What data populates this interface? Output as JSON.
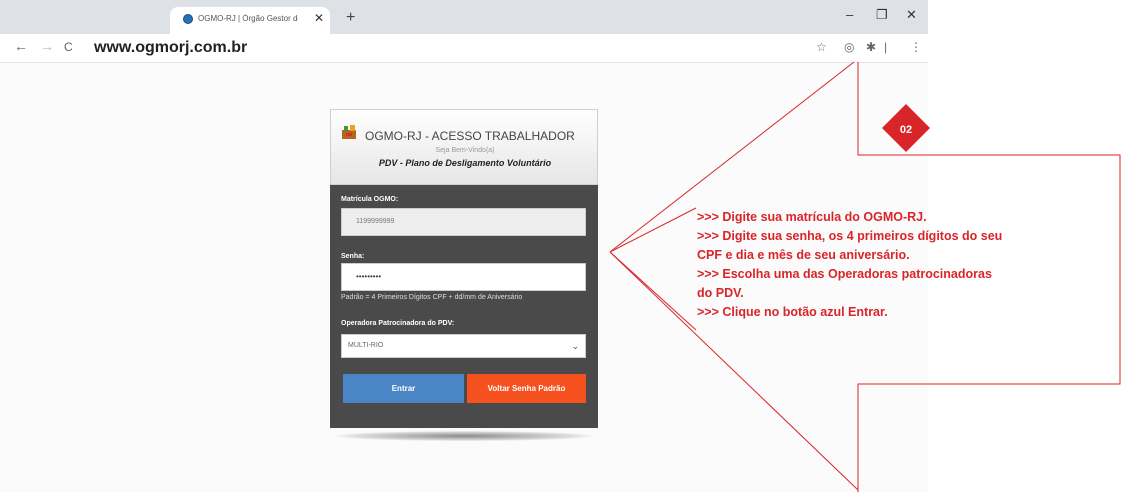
{
  "browser": {
    "tab_title": "OGMO-RJ | Órgão Gestor de Mã",
    "tab_close": "✕",
    "new_tab": "+",
    "window_controls": {
      "minimize": "–",
      "restore": "❐",
      "close": "✕"
    },
    "nav": {
      "back": "←",
      "forward": "→",
      "reload": "C"
    },
    "url": "www.ogmorj.com.br",
    "toolbar_icons": {
      "star": "☆",
      "extension": "◎",
      "puzzle": "✱",
      "profile": "|",
      "menu": "⋮"
    }
  },
  "login": {
    "title": "OGMO-RJ - ACESSO TRABALHADOR",
    "welcome": "Seja Bem-Vindo(a)",
    "subtitle": "PDV - Plano de Desligamento Voluntário",
    "matricula_label": "Matrícula OGMO:",
    "matricula_value": "1199999999",
    "senha_label": "Senha:",
    "senha_value": "•••••••••",
    "senha_hint": "Padrão = 4 Primeiros Dígitos CPF + dd/mm de Aniversário",
    "operadora_label": "Operadora Patrocinadora do PDV:",
    "operadora_selected": "MULTI-RIO",
    "entrar_button": "Entrar",
    "voltar_button": "Voltar Senha Padrão"
  },
  "annotation": {
    "badge": "02",
    "lines": [
      ">>> Digite sua matrícula do OGMO-RJ.",
      ">>> Digite sua senha, os 4 primeiros dígitos do seu",
      "CPF e dia e mês de seu aniversário.",
      ">>> Escolha uma das Operadoras patrocinadoras",
      "do PDV.",
      ">>> Clique no botão azul Entrar."
    ]
  },
  "colors": {
    "annotation_red": "#d9252a",
    "entrar_blue": "#4a86c5",
    "voltar_orange": "#f4511e",
    "form_dark": "#4a4a4a"
  }
}
